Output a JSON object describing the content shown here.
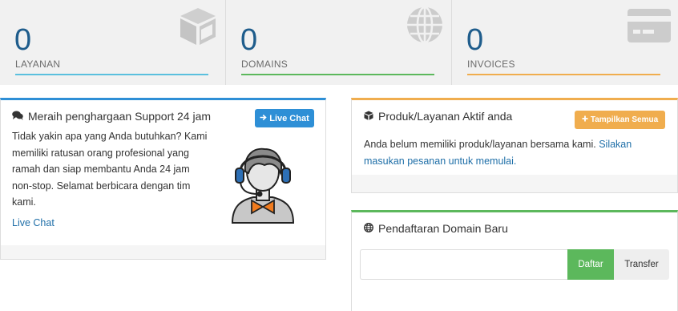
{
  "stats": [
    {
      "count": "0",
      "label": "LAYANAN",
      "color": "#5bc0de",
      "icon": "cube-icon"
    },
    {
      "count": "0",
      "label": "DOMAINS",
      "color": "#5cb85c",
      "icon": "globe-icon"
    },
    {
      "count": "0",
      "label": "INVOICES",
      "color": "#f0ad4e",
      "icon": "credit-card-icon"
    }
  ],
  "support": {
    "title": "Meraih penghargaan Support 24 jam",
    "button_label": "Live Chat",
    "text": "Tidak yakin apa yang Anda butuhkan? Kami memiliki ratusan orang profesional yang ramah dan siap membantu Anda 24 jam non-stop. Selamat berbicara dengan tim kami.",
    "link_label": "Live Chat",
    "accent": "#2e8fd6",
    "icon": "comments-icon",
    "illustration": "support-agent-headset"
  },
  "products": {
    "title": "Produk/Layanan Aktif anda",
    "button_label": "Tampilkan Semua",
    "text": "Anda belum memiliki produk/layanan bersama kami.",
    "link_text": "Silakan masukan pesanan untuk memulai.",
    "accent": "#f0ad4e",
    "icon": "cube-icon"
  },
  "domain_register": {
    "title": "Pendaftaran Domain Baru",
    "input_value": "",
    "input_placeholder": "",
    "register_label": "Daftar",
    "transfer_label": "Transfer",
    "accent": "#5cb85c",
    "icon": "globe-icon"
  }
}
